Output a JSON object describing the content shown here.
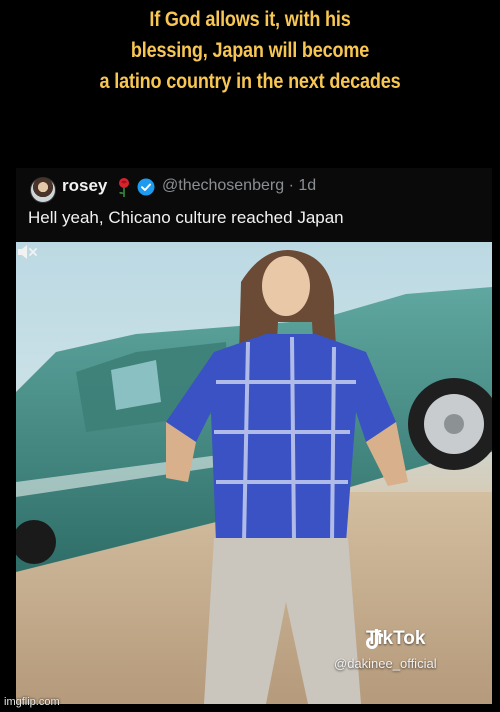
{
  "caption": {
    "line1": "If God allows it, with his",
    "line2": "blessing, Japan will become",
    "line3": "a latino country in the next decades",
    "color": "#f7c653"
  },
  "tweet": {
    "display_name": "rosey",
    "name_emoji_icon": "rose-icon",
    "verified_icon": "verified-icon",
    "handle": "@thechosenberg",
    "separator": "·",
    "time": "1d",
    "text": "Hell yeah, Chicano culture reached Japan"
  },
  "video": {
    "platform": "TikTok",
    "username": "@dakinee_official",
    "icons": [
      "tiktok-note-icon",
      "mute-icon"
    ]
  },
  "watermark": "imgflip.com"
}
